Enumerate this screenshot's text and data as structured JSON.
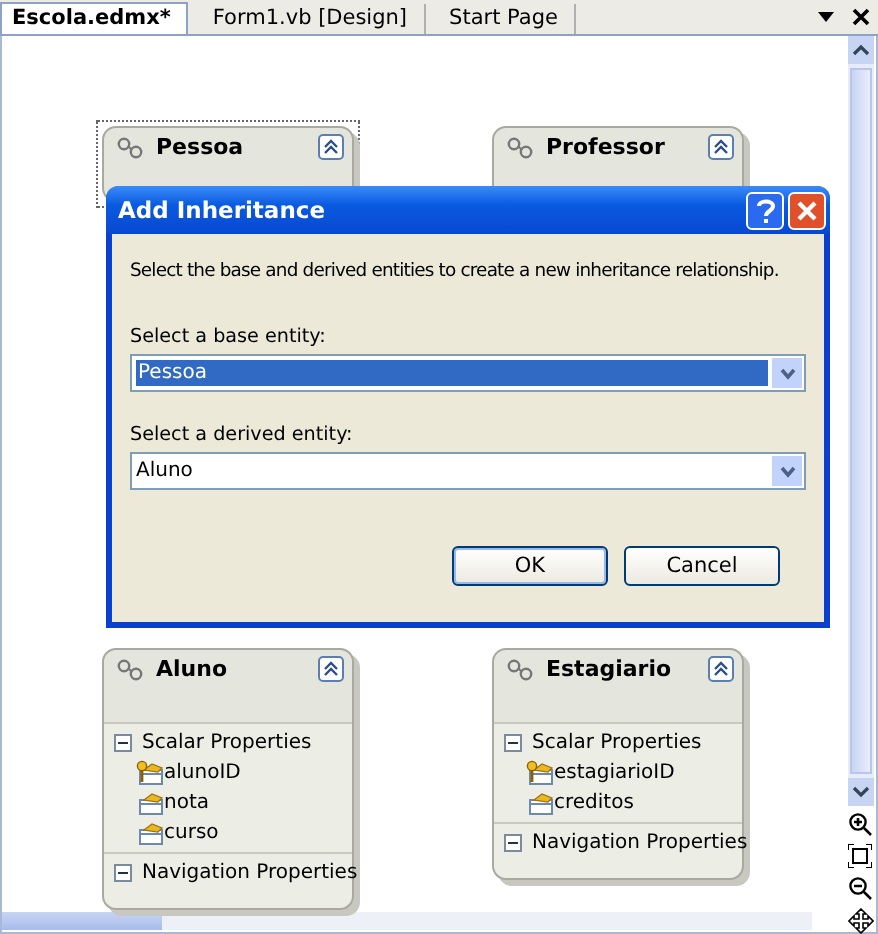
{
  "tabs": [
    {
      "label": "Escola.edmx*",
      "selected": true
    },
    {
      "label": "Form1.vb [Design]",
      "selected": false
    },
    {
      "label": "Start Page",
      "selected": false
    }
  ],
  "entities": [
    {
      "name": "Pessoa",
      "selected": true
    },
    {
      "name": "Professor",
      "selected": false
    },
    {
      "name": "Aluno",
      "selected": false,
      "sections": [
        {
          "label": "Scalar Properties",
          "expanded": true,
          "properties": [
            {
              "name": "alunoID",
              "key": true
            },
            {
              "name": "nota",
              "key": false
            },
            {
              "name": "curso",
              "key": false
            }
          ]
        },
        {
          "label": "Navigation Properties",
          "expanded": true
        }
      ]
    },
    {
      "name": "Estagiario",
      "selected": false,
      "sections": [
        {
          "label": "Scalar Properties",
          "expanded": true,
          "properties": [
            {
              "name": "estagiarioID",
              "key": true
            },
            {
              "name": "creditos",
              "key": false
            }
          ]
        },
        {
          "label": "Navigation Properties",
          "expanded": true
        }
      ]
    }
  ],
  "dialog": {
    "title": "Add Inheritance",
    "message": "Select the base and derived entities to create a new inheritance relationship.",
    "fields": [
      {
        "label": "Select a base entity:",
        "value": "Pessoa",
        "focused": true
      },
      {
        "label": "Select a derived entity:",
        "value": "Aluno",
        "focused": false
      }
    ],
    "buttons": [
      {
        "label": "OK",
        "default": true
      },
      {
        "label": "Cancel",
        "default": false
      }
    ]
  }
}
